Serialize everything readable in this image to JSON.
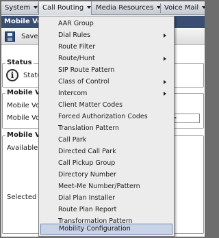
{
  "menubar": {
    "items": [
      "System",
      "Call Routing",
      "Media Resources",
      "Voice Mail"
    ]
  },
  "page": {
    "title": "Mobile Vo",
    "toolbar_save": "Save",
    "status_legend": "Status",
    "status_text": "Statu",
    "section1_legend": "Mobile Vo",
    "section1_row1": "Mobile Vo",
    "section1_row2": "Mobile Vo",
    "section1_field_fragment": ">",
    "section2_legend": "Mobile Vo",
    "available_label": "Available",
    "selected_label": "Selected"
  },
  "dropdown": {
    "items": [
      {
        "label": "AAR Group",
        "submenu": false
      },
      {
        "label": "Dial Rules",
        "submenu": true
      },
      {
        "label": "Route Filter",
        "submenu": false
      },
      {
        "label": "Route/Hunt",
        "submenu": true
      },
      {
        "label": "SIP Route Pattern",
        "submenu": false
      },
      {
        "label": "Class of Control",
        "submenu": true
      },
      {
        "label": "Intercom",
        "submenu": true
      },
      {
        "label": "Client Matter Codes",
        "submenu": false
      },
      {
        "label": "Forced Authorization Codes",
        "submenu": false
      },
      {
        "label": "Translation Pattern",
        "submenu": false
      },
      {
        "label": "Call Park",
        "submenu": false
      },
      {
        "label": "Directed Call Park",
        "submenu": false
      },
      {
        "label": "Call Pickup Group",
        "submenu": false
      },
      {
        "label": "Directory Number",
        "submenu": false
      },
      {
        "label": "Meet-Me Number/Pattern",
        "submenu": false
      },
      {
        "label": "Dial Plan Installer",
        "submenu": false
      },
      {
        "label": "Route Plan Report",
        "submenu": false
      },
      {
        "label": "Transformation Pattern",
        "submenu": false
      },
      {
        "label": "Mobility Configuration",
        "submenu": false,
        "highlighted": true
      }
    ]
  }
}
